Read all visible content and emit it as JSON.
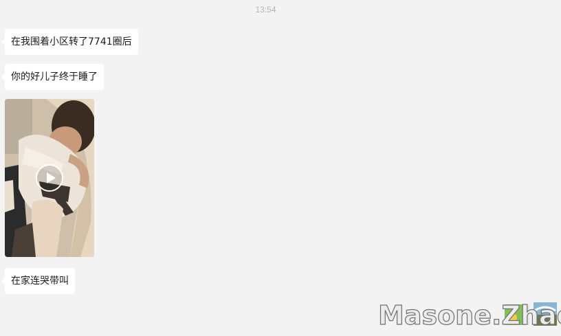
{
  "chat": {
    "timestamp": "13:54",
    "messages": [
      {
        "type": "text",
        "text": "在我围着小区转了7741圈后"
      },
      {
        "type": "text",
        "text": "你的好儿子终于睡了"
      },
      {
        "type": "video",
        "icon": "play-icon"
      },
      {
        "type": "text",
        "text": "在家连哭带叫"
      }
    ]
  },
  "watermark": {
    "text": "Masone.Zhao"
  }
}
